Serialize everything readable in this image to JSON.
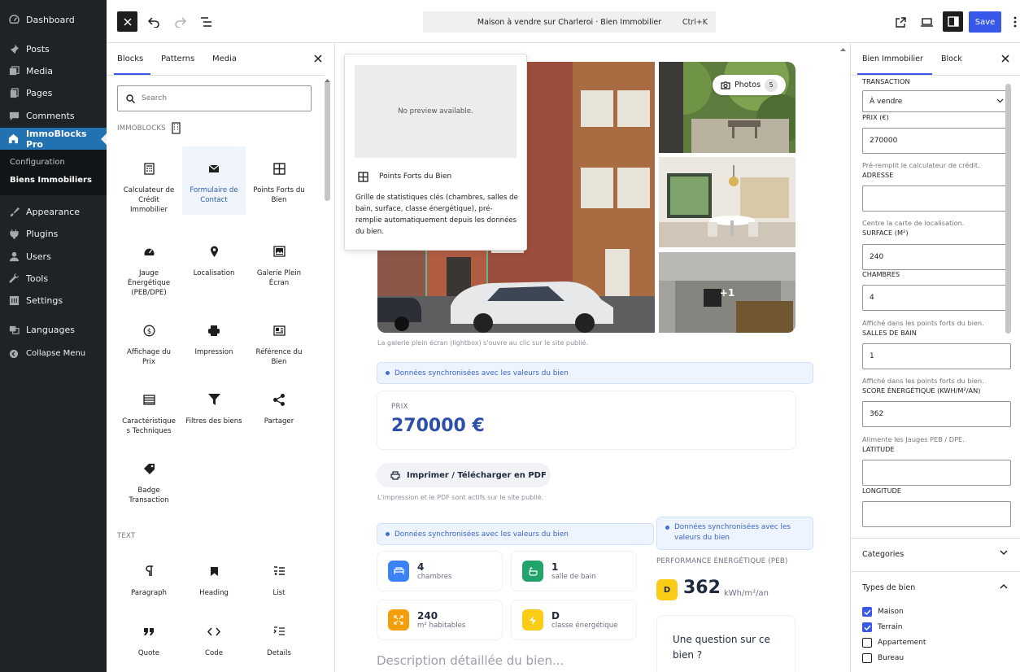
{
  "admin_menu": {
    "items": [
      {
        "label": "Dashboard",
        "icon": "dashboard-icon"
      },
      {
        "label": "Posts",
        "icon": "pin-icon"
      },
      {
        "label": "Media",
        "icon": "media-icon"
      },
      {
        "label": "Pages",
        "icon": "pages-icon"
      },
      {
        "label": "Comments",
        "icon": "comments-icon"
      },
      {
        "label": "ImmoBlocks Pro",
        "icon": "house-icon"
      },
      {
        "label": "Appearance",
        "icon": "brush-icon"
      },
      {
        "label": "Plugins",
        "icon": "plugin-icon"
      },
      {
        "label": "Users",
        "icon": "users-icon"
      },
      {
        "label": "Tools",
        "icon": "wrench-icon"
      },
      {
        "label": "Settings",
        "icon": "settings-icon"
      },
      {
        "label": "Languages",
        "icon": "languages-icon"
      },
      {
        "label": "Collapse Menu",
        "icon": "collapse-icon"
      }
    ],
    "submenu": [
      "Configuration",
      "Biens Immobiliers"
    ]
  },
  "toolbar": {
    "doc_title": "Maison à vendre sur Charleroi · Bien Immobilier",
    "shortcut": "Ctrl+K",
    "save_label": "Save"
  },
  "inserter": {
    "tabs": [
      "Blocks",
      "Patterns",
      "Media"
    ],
    "search_placeholder": "Search",
    "category_immo": "IMMOBLOCKS",
    "category_text": "TEXT",
    "immo_blocks": [
      "Calculateur de Crédit Immobilier",
      "Formulaire de Contact",
      "Points Forts du Bien",
      "Jauge Énergétique (PEB/DPE)",
      "Localisation",
      "Galerie Plein Écran",
      "Affichage du Prix",
      "Impression",
      "Référence du Bien",
      "Caractéristique s Techniques",
      "Filtres des biens",
      "Partager",
      "Badge Transaction"
    ],
    "text_blocks": [
      "Paragraph",
      "Heading",
      "List",
      "Quote",
      "Code",
      "Details"
    ]
  },
  "preview": {
    "no_preview": "No preview available.",
    "title": "Points Forts du Bien",
    "description": "Grille de statistiques clés (chambres, salles de bain, surface, classe énergétique), pré-remplie automatiquement depuis les données du bien."
  },
  "canvas": {
    "photos_label": "Photos",
    "photos_count": "5",
    "more_photos": "+1",
    "gallery_note": "La galerie plein écran (lightbox) s'ouvre au clic sur le site publié.",
    "sync_label": "Données synchronisées avec les valeurs du bien",
    "price_label": "PRIX",
    "price_value": "270000 €",
    "print_button": "Imprimer / Télécharger en PDF",
    "print_note": "L'impression et le PDF sont actifs sur le site publié.",
    "sync_label_2": "Données synchronisées avec les valeurs du bien",
    "sync_label_3": "Données synchronisées avec les valeurs du bien",
    "stats": [
      {
        "value": "4",
        "label": "chambres",
        "color": "#3b82f6"
      },
      {
        "value": "1",
        "label": "salle de bain",
        "color": "#22a36b"
      },
      {
        "value": "240",
        "label": "m² habitables",
        "color": "#f59e0b"
      },
      {
        "value": "D",
        "label": "classe énergétique",
        "color": "#facc15"
      }
    ],
    "energy_heading": "PERFORMANCE ÉNERGÉTIQUE (PEB)",
    "energy_class": "D",
    "energy_value": "362",
    "energy_unit": "kWh/m²/an",
    "question": "Une question sur ce bien ?",
    "description_placeholder": "Description détaillée du bien..."
  },
  "settings": {
    "tabs": [
      "Bien Immobilier",
      "Block"
    ],
    "fields": {
      "transaction_label": "TRANSACTION",
      "transaction_value": "À vendre",
      "price_label": "PRIX (€)",
      "price_value": "270000",
      "price_help": "Pré-remplit le calculateur de crédit.",
      "address_label": "ADRESSE",
      "address_help": "Centre la carte de localisation.",
      "surface_label": "SURFACE (M²)",
      "surface_value": "240",
      "rooms_label": "CHAMBRES",
      "rooms_value": "4",
      "rooms_help": "Affiché dans les points forts du bien.",
      "baths_label": "SALLES DE BAIN",
      "baths_value": "1",
      "baths_help": "Affiché dans les points forts du bien.",
      "energy_label": "SCORE ÉNERGÉTIQUE (KWH/M²/AN)",
      "energy_value": "362",
      "energy_help": "Alimente les Jauges PEB / DPE.",
      "lat_label": "LATITUDE",
      "lng_label": "LONGITUDE"
    },
    "categories_label": "Categories",
    "types_label": "Types de bien",
    "types": [
      {
        "label": "Maison",
        "checked": true
      },
      {
        "label": "Terrain",
        "checked": true
      },
      {
        "label": "Appartement",
        "checked": false
      },
      {
        "label": "Bureau",
        "checked": false
      }
    ]
  },
  "colors": {
    "accent": "#3858e9",
    "admin_active": "#2271b1",
    "admin_bg": "#1d2327",
    "price_blue": "#2d4fa8"
  }
}
